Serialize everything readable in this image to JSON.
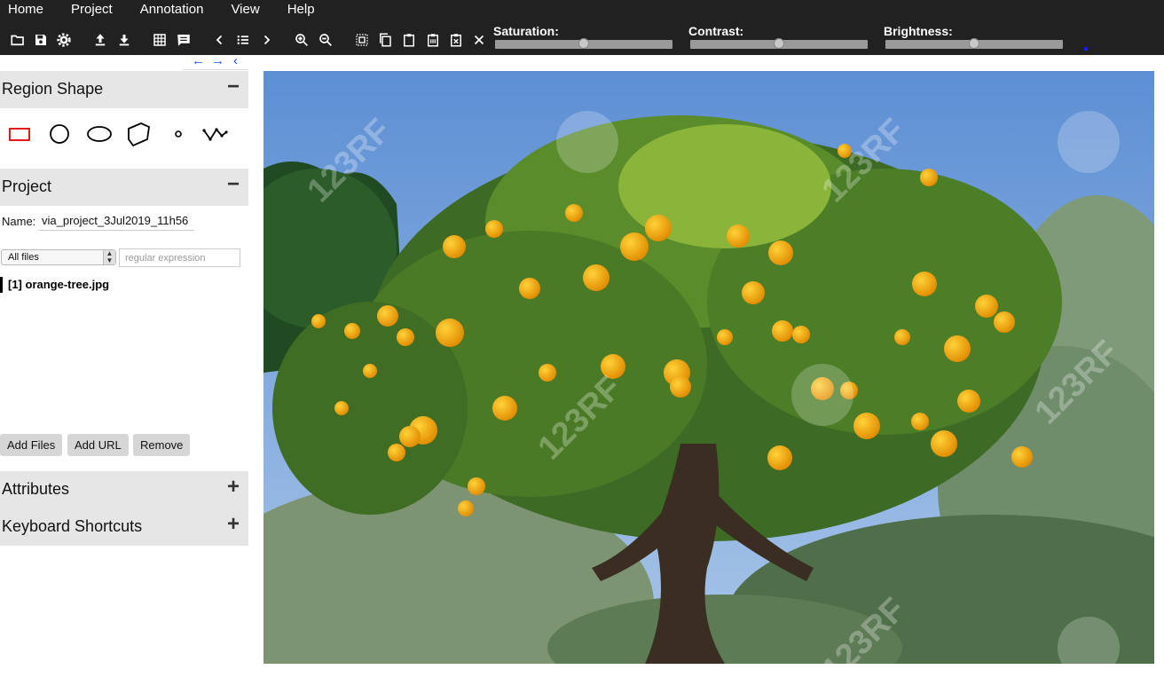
{
  "menu": [
    "Home",
    "Project",
    "Annotation",
    "View",
    "Help"
  ],
  "toolbar": {
    "icons": [
      "folder-open-icon",
      "save-icon",
      "settings-icon",
      "upload-icon",
      "download-icon",
      "grid-icon",
      "comment-icon",
      "prev-icon",
      "list-icon",
      "next-icon",
      "zoom-in-icon",
      "zoom-out-icon",
      "select-all-icon",
      "copy-icon",
      "paste-icon",
      "paste-special-icon",
      "delete-icon",
      "close-icon"
    ]
  },
  "sliders": [
    {
      "label": "Saturation:",
      "value": 0.5
    },
    {
      "label": "Contrast:",
      "value": 0.5
    },
    {
      "label": "Brightness:",
      "value": 0.5
    }
  ],
  "nav_arrows": [
    "←",
    "→",
    "‹"
  ],
  "region_shape": {
    "title": "Region Shape",
    "toggle": "−",
    "shapes": [
      "rectangle",
      "circle",
      "ellipse",
      "polygon",
      "point",
      "polyline"
    ],
    "selected": "rectangle",
    "selected_color": "#e00000"
  },
  "project": {
    "title": "Project",
    "toggle": "−",
    "name_label": "Name:",
    "name_value": "via_project_3Jul2019_11h56",
    "filter_selected": "All files",
    "regex_placeholder": "regular expression",
    "files": [
      "[1] orange-tree.jpg"
    ],
    "buttons": [
      "Add Files",
      "Add URL",
      "Remove"
    ]
  },
  "attributes": {
    "title": "Attributes",
    "toggle": "+"
  },
  "shortcuts": {
    "title": "Keyboard Shortcuts",
    "toggle": "+"
  },
  "image": {
    "filename": "orange-tree.jpg",
    "watermark": "123RF"
  }
}
